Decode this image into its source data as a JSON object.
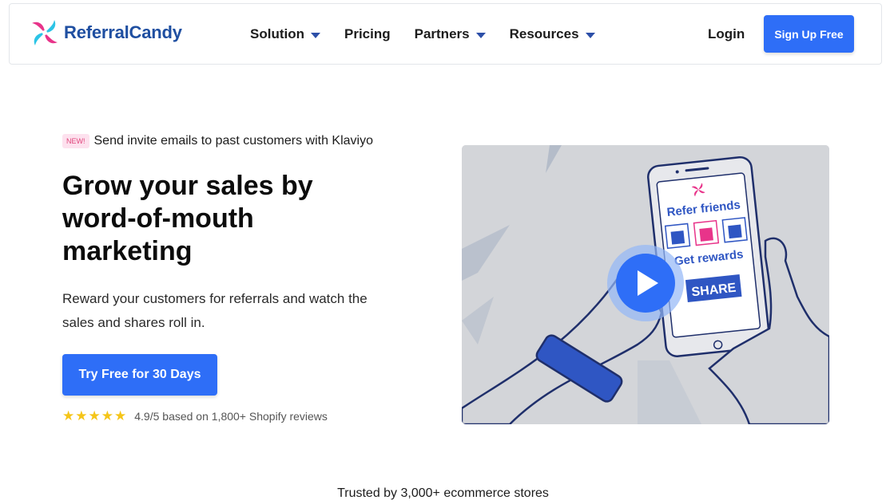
{
  "brand": {
    "name": "ReferralCandy"
  },
  "nav": {
    "items": [
      {
        "label": "Solution",
        "dropdown": true
      },
      {
        "label": "Pricing",
        "dropdown": false
      },
      {
        "label": "Partners",
        "dropdown": true
      },
      {
        "label": "Resources",
        "dropdown": true
      }
    ],
    "login": "Login",
    "signup": "Sign Up Free"
  },
  "hero": {
    "badge": "NEW!",
    "announcement": "Send invite emails to past customers with Klaviyo",
    "headline": "Grow your sales by word-of-mouth marketing",
    "subtext": "Reward your customers for referrals and watch the sales and shares roll in.",
    "cta": "Try Free for 30 Days",
    "rating": {
      "stars": 5,
      "text": "4.9/5 based on 1,800+ Shopify reviews"
    }
  },
  "video": {
    "phone_title": "Refer friends",
    "phone_sub": "Get rewards",
    "phone_button": "SHARE"
  },
  "trusted": "Trusted by 3,000+ ecommerce stores",
  "colors": {
    "accent": "#2e6ef7",
    "brand_blue": "#1f4fa1",
    "badge_pink": "#fde1ee",
    "star": "#f5c518"
  }
}
